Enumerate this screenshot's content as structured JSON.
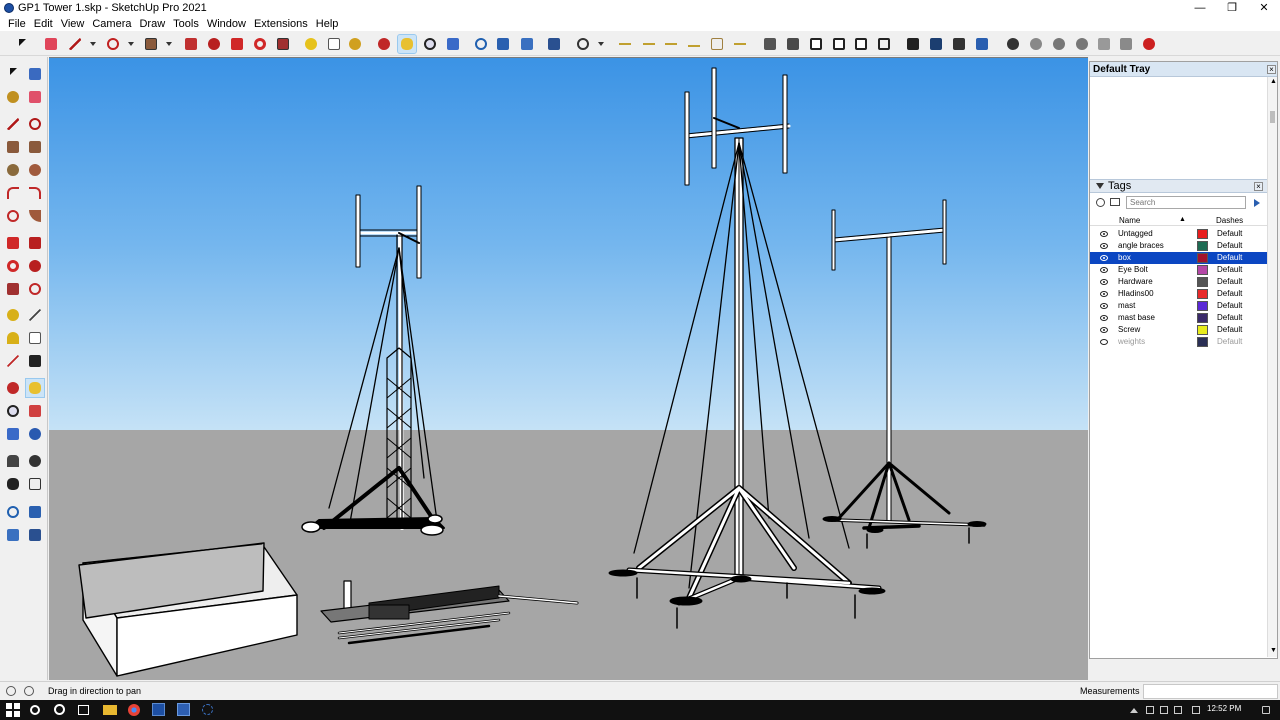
{
  "window": {
    "title": "GP1 Tower 1.skp - SketchUp Pro 2021",
    "minimize": "—",
    "maximize": "❐",
    "close": "✕"
  },
  "menu": [
    "File",
    "Edit",
    "View",
    "Camera",
    "Draw",
    "Tools",
    "Window",
    "Extensions",
    "Help"
  ],
  "tray": {
    "title": "Default Tray",
    "tags_title": "Tags",
    "search_placeholder": "Search",
    "col_name": "Name",
    "col_dashes": "Dashes",
    "tags": [
      {
        "name": "Untagged",
        "color": "#e81e1e",
        "dashes": "Default",
        "visible": true,
        "selected": false
      },
      {
        "name": "angle braces",
        "color": "#1e6b53",
        "dashes": "Default",
        "visible": true,
        "selected": false
      },
      {
        "name": "box",
        "color": "#a3112e",
        "dashes": "Default",
        "visible": true,
        "selected": true
      },
      {
        "name": "Eye Bolt",
        "color": "#b446a6",
        "dashes": "Default",
        "visible": true,
        "selected": false
      },
      {
        "name": "Hardware",
        "color": "#555555",
        "dashes": "Default",
        "visible": true,
        "selected": false
      },
      {
        "name": "Hladins00",
        "color": "#e82a2a",
        "dashes": "Default",
        "visible": true,
        "selected": false
      },
      {
        "name": "mast",
        "color": "#5a28d6",
        "dashes": "Default",
        "visible": true,
        "selected": false
      },
      {
        "name": "mast base",
        "color": "#3a2a6a",
        "dashes": "Default",
        "visible": true,
        "selected": false
      },
      {
        "name": "Screw",
        "color": "#e8ec1c",
        "dashes": "Default",
        "visible": true,
        "selected": false
      },
      {
        "name": "weights",
        "color": "#2a2f55",
        "dashes": "Default",
        "visible": false,
        "selected": false
      }
    ]
  },
  "status": {
    "hint": "Drag in direction to pan",
    "measurements_label": "Measurements"
  },
  "taskbar": {
    "time": "12:52 PM"
  }
}
